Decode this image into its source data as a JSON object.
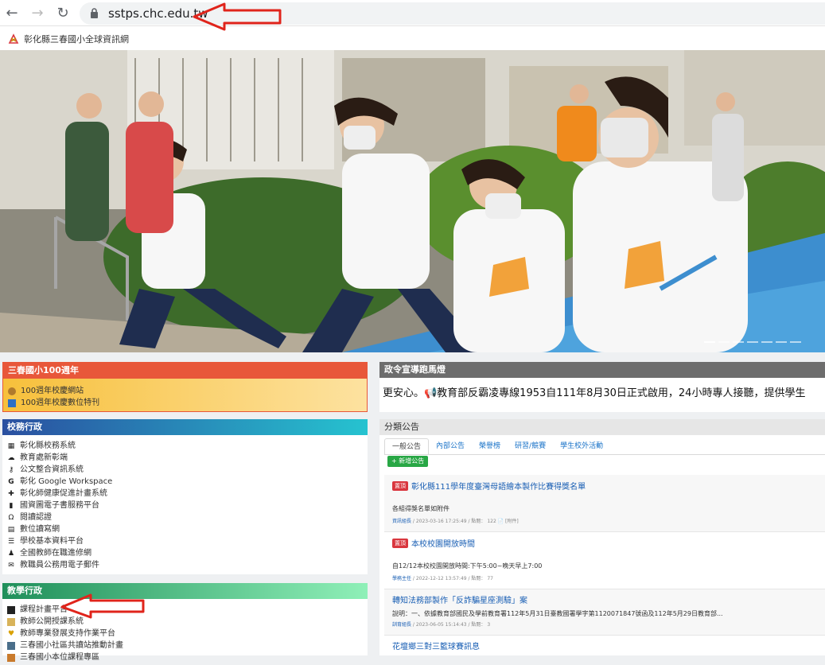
{
  "browser": {
    "url": "sstps.chc.edu.tw"
  },
  "bookmarks": [
    {
      "label": "彰化縣三春國小全球資訊網"
    }
  ],
  "centennial": {
    "title": "三春國小100週年",
    "color": "#e8573a",
    "items": [
      {
        "label": "100週年校慶網站",
        "icon": "globe-icon"
      },
      {
        "label": "100週年校慶數位特刊",
        "icon": "book-icon"
      }
    ]
  },
  "marquee": {
    "title": "政令宣導跑馬燈",
    "text": "更安心。📢教育部反霸凌專線1953自111年8月30日正式啟用，24小時專人接聽，提供學生"
  },
  "admin": {
    "title": "校務行政",
    "items": [
      {
        "label": "彰化縣校務系統",
        "icon": "grid-icon"
      },
      {
        "label": "教育處新彰端",
        "icon": "cloud-icon"
      },
      {
        "label": "公文整合資訊系統",
        "icon": "key-icon"
      },
      {
        "label": "彰化 Google Workspace",
        "icon": "google-icon"
      },
      {
        "label": "彰化師健康促進計畫系統",
        "icon": "heart-icon"
      },
      {
        "label": "國資圖電子書服務平台",
        "icon": "book-icon"
      },
      {
        "label": "閱讀認證",
        "icon": "ribbon-icon"
      },
      {
        "label": "數位讀寫網",
        "icon": "document-icon"
      },
      {
        "label": "學校基本資料平台",
        "icon": "list-icon"
      },
      {
        "label": "全國教師在職進修網",
        "icon": "users-icon"
      },
      {
        "label": "教職員公務用電子郵件",
        "icon": "mail-icon"
      }
    ]
  },
  "teaching": {
    "title": "教學行政",
    "items": [
      {
        "label": "課程計畫平台",
        "icon": "monitor-icon"
      },
      {
        "label": "教師公開授課系統",
        "icon": "teacher-icon"
      },
      {
        "label": "教師專業發展支持作業平台",
        "icon": "heart-icon"
      },
      {
        "label": "三春國小社區共讀站推動計畫",
        "icon": "notebook-icon"
      },
      {
        "label": "三春國小本位課程專區",
        "icon": "folder-icon"
      }
    ]
  },
  "announcements": {
    "title": "分類公告",
    "tabs": [
      "一般公告",
      "內部公告",
      "榮譽榜",
      "研習/競賽",
      "學生校外活動"
    ],
    "add_label": "+ 新增公告",
    "items": [
      {
        "tag": "置頂",
        "title": "彰化縣111學年度臺灣母語繪本製作比賽得獎名單",
        "desc": "各組得獎名單如附件",
        "dept": "資訊組長",
        "meta": " / 2023-03-16 17:25:49 / 點閱： 122 📄 [附件]"
      },
      {
        "tag": "置頂",
        "title": "本校校園開放時間",
        "desc": "自12/12本校校園開放時間:下午5:00~晚天早上7:00",
        "dept": "學務主任",
        "meta": " / 2022-12-12 13:57:49 / 點閱： 77"
      },
      {
        "tag": "",
        "title": "轉知法務部製作「反詐騙星座測驗」案",
        "desc": "說明：一、依據教育部國民及學前教育署112年5月31日臺教國署學字第1120071847號函及112年5月29日教育部...",
        "dept": "訓育組長",
        "meta": " / 2023-06-05 15:14:43 / 點閱： 3"
      },
      {
        "tag": "",
        "title": "花壇鄉三對三籃球賽訊息",
        "desc": "",
        "dept": "",
        "meta": ""
      }
    ]
  }
}
